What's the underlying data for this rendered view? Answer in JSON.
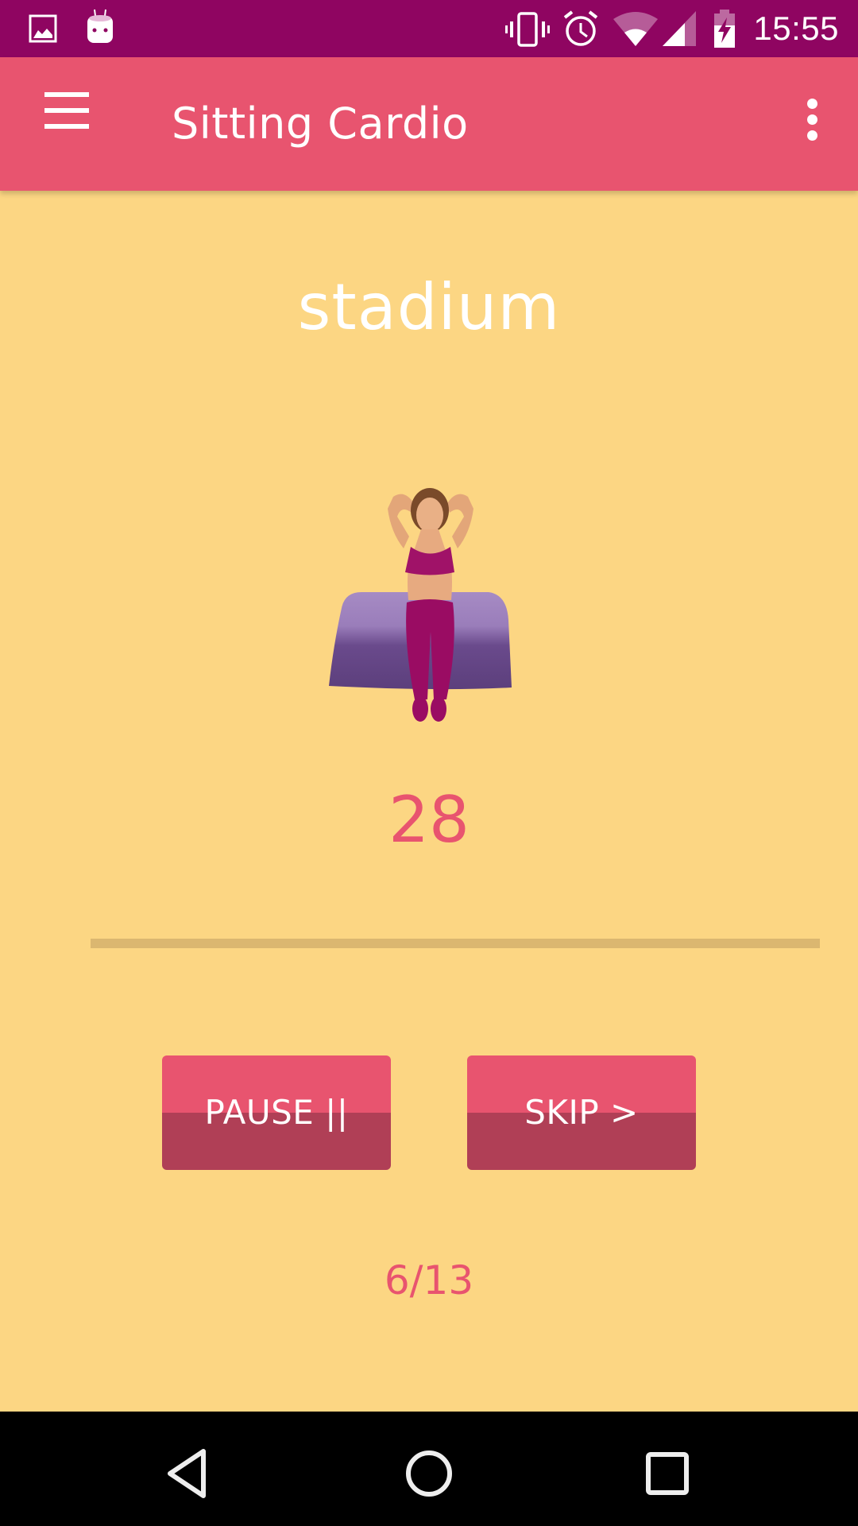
{
  "status_bar": {
    "left_icons": [
      "gallery-notification-icon",
      "android-robot-icon"
    ],
    "right_icons": [
      "vibrate-icon",
      "alarm-icon",
      "wifi-icon",
      "cell-signal-icon",
      "battery-charging-icon"
    ],
    "time": "15:55"
  },
  "app_bar": {
    "menu_icon": "hamburger-menu-icon",
    "title": "Sitting Cardio",
    "overflow_icon": "more-vertical-icon"
  },
  "exercise": {
    "name": "stadium",
    "illustration": "woman-seated-on-mat-hands-behind-head",
    "timer_seconds": "28",
    "progress_percent": 0
  },
  "controls": {
    "pause_label": "PAUSE ||",
    "skip_label": "SKIP >"
  },
  "counter": "6/13",
  "nav_bar": {
    "back_icon": "back-triangle-icon",
    "home_icon": "home-circle-icon",
    "recents_icon": "recents-square-icon"
  },
  "colors": {
    "status_bar": "#8F0561",
    "app_bar": "#E8546F",
    "background": "#FCD683",
    "accent": "#E8546F",
    "button_dark": "#B03F56",
    "progress_track": "#DBB770"
  }
}
